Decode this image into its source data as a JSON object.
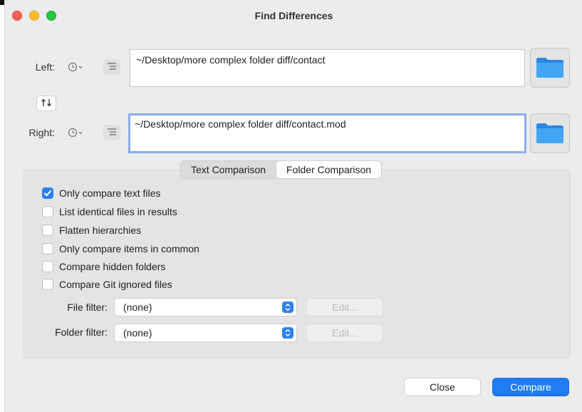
{
  "window": {
    "title": "Find Differences"
  },
  "left": {
    "label": "Left:",
    "path": "~/Desktop/more complex folder diff/contact"
  },
  "right": {
    "label": "Right:",
    "path": "~/Desktop/more complex folder diff/contact.mod"
  },
  "tabs": [
    {
      "label": "Text Comparison",
      "selected": false
    },
    {
      "label": "Folder Comparison",
      "selected": true
    }
  ],
  "options": [
    {
      "label": "Only compare text files",
      "checked": true
    },
    {
      "label": "List identical files in results",
      "checked": false
    },
    {
      "label": "Flatten hierarchies",
      "checked": false
    },
    {
      "label": "Only compare items in common",
      "checked": false
    },
    {
      "label": "Compare hidden folders",
      "checked": false
    },
    {
      "label": "Compare Git ignored files",
      "checked": false
    }
  ],
  "file_filter": {
    "label": "File filter:",
    "value": "(none)",
    "edit_label": "Edit..."
  },
  "folder_filter": {
    "label": "Folder filter:",
    "value": "(none)",
    "edit_label": "Edit..."
  },
  "buttons": {
    "close": "Close",
    "compare": "Compare"
  },
  "colors": {
    "accent": "#1f7cf3",
    "focus_ring": "#8aaeea",
    "folder": "#3a9cf0"
  }
}
